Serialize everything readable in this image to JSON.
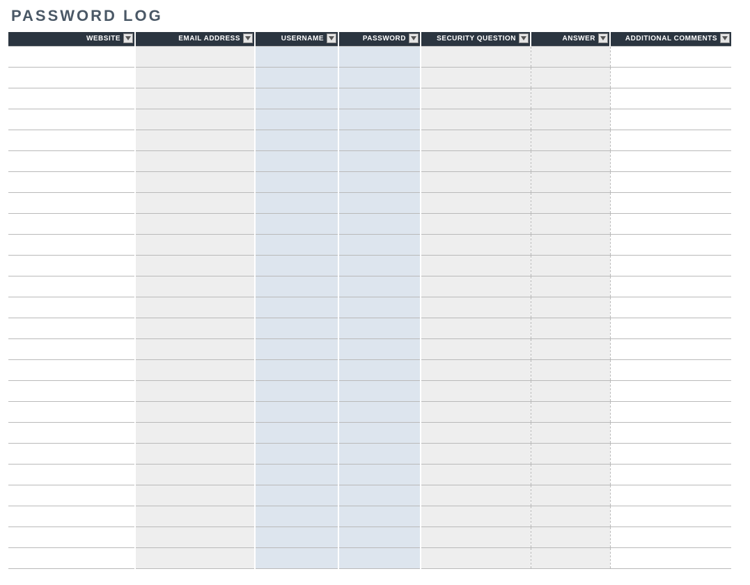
{
  "title": "PASSWORD LOG",
  "columns": [
    {
      "key": "website",
      "label": "WEBSITE",
      "cls": "c-website",
      "wcls": "w-website"
    },
    {
      "key": "email",
      "label": "EMAIL ADDRESS",
      "cls": "c-email",
      "wcls": "w-email"
    },
    {
      "key": "username",
      "label": "USERNAME",
      "cls": "c-username",
      "wcls": "w-username"
    },
    {
      "key": "password",
      "label": "PASSWORD",
      "cls": "c-password",
      "wcls": "w-password"
    },
    {
      "key": "security",
      "label": "SECURITY QUESTION",
      "cls": "c-security",
      "wcls": "w-security"
    },
    {
      "key": "answer",
      "label": "ANSWER",
      "cls": "c-answer",
      "wcls": "w-answer"
    },
    {
      "key": "comments",
      "label": "ADDITIONAL COMMENTS",
      "cls": "c-comments",
      "wcls": "w-comments"
    }
  ],
  "rows": [
    {
      "website": "",
      "email": "",
      "username": "",
      "password": "",
      "security": "",
      "answer": "",
      "comments": ""
    },
    {
      "website": "",
      "email": "",
      "username": "",
      "password": "",
      "security": "",
      "answer": "",
      "comments": ""
    },
    {
      "website": "",
      "email": "",
      "username": "",
      "password": "",
      "security": "",
      "answer": "",
      "comments": ""
    },
    {
      "website": "",
      "email": "",
      "username": "",
      "password": "",
      "security": "",
      "answer": "",
      "comments": ""
    },
    {
      "website": "",
      "email": "",
      "username": "",
      "password": "",
      "security": "",
      "answer": "",
      "comments": ""
    },
    {
      "website": "",
      "email": "",
      "username": "",
      "password": "",
      "security": "",
      "answer": "",
      "comments": ""
    },
    {
      "website": "",
      "email": "",
      "username": "",
      "password": "",
      "security": "",
      "answer": "",
      "comments": ""
    },
    {
      "website": "",
      "email": "",
      "username": "",
      "password": "",
      "security": "",
      "answer": "",
      "comments": ""
    },
    {
      "website": "",
      "email": "",
      "username": "",
      "password": "",
      "security": "",
      "answer": "",
      "comments": ""
    },
    {
      "website": "",
      "email": "",
      "username": "",
      "password": "",
      "security": "",
      "answer": "",
      "comments": ""
    },
    {
      "website": "",
      "email": "",
      "username": "",
      "password": "",
      "security": "",
      "answer": "",
      "comments": ""
    },
    {
      "website": "",
      "email": "",
      "username": "",
      "password": "",
      "security": "",
      "answer": "",
      "comments": ""
    },
    {
      "website": "",
      "email": "",
      "username": "",
      "password": "",
      "security": "",
      "answer": "",
      "comments": ""
    },
    {
      "website": "",
      "email": "",
      "username": "",
      "password": "",
      "security": "",
      "answer": "",
      "comments": ""
    },
    {
      "website": "",
      "email": "",
      "username": "",
      "password": "",
      "security": "",
      "answer": "",
      "comments": ""
    },
    {
      "website": "",
      "email": "",
      "username": "",
      "password": "",
      "security": "",
      "answer": "",
      "comments": ""
    },
    {
      "website": "",
      "email": "",
      "username": "",
      "password": "",
      "security": "",
      "answer": "",
      "comments": ""
    },
    {
      "website": "",
      "email": "",
      "username": "",
      "password": "",
      "security": "",
      "answer": "",
      "comments": ""
    },
    {
      "website": "",
      "email": "",
      "username": "",
      "password": "",
      "security": "",
      "answer": "",
      "comments": ""
    },
    {
      "website": "",
      "email": "",
      "username": "",
      "password": "",
      "security": "",
      "answer": "",
      "comments": ""
    },
    {
      "website": "",
      "email": "",
      "username": "",
      "password": "",
      "security": "",
      "answer": "",
      "comments": ""
    },
    {
      "website": "",
      "email": "",
      "username": "",
      "password": "",
      "security": "",
      "answer": "",
      "comments": ""
    },
    {
      "website": "",
      "email": "",
      "username": "",
      "password": "",
      "security": "",
      "answer": "",
      "comments": ""
    },
    {
      "website": "",
      "email": "",
      "username": "",
      "password": "",
      "security": "",
      "answer": "",
      "comments": ""
    },
    {
      "website": "",
      "email": "",
      "username": "",
      "password": "",
      "security": "",
      "answer": "",
      "comments": ""
    }
  ]
}
